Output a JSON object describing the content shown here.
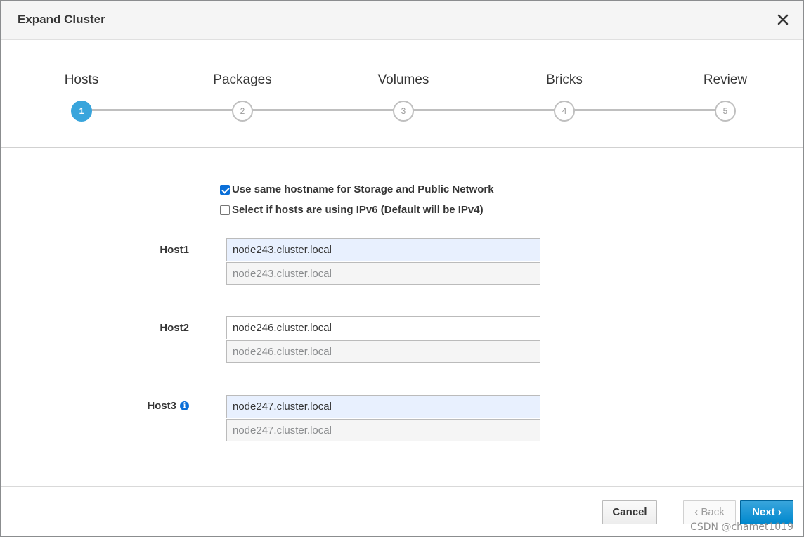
{
  "modal": {
    "title": "Expand Cluster",
    "close_icon": "close-icon"
  },
  "wizard": {
    "steps": [
      {
        "label": "Hosts",
        "number": "1",
        "active": true
      },
      {
        "label": "Packages",
        "number": "2",
        "active": false
      },
      {
        "label": "Volumes",
        "number": "3",
        "active": false
      },
      {
        "label": "Bricks",
        "number": "4",
        "active": false
      },
      {
        "label": "Review",
        "number": "5",
        "active": false
      }
    ]
  },
  "options": {
    "same_hostname": {
      "label": "Use same hostname for Storage and Public Network",
      "checked": true
    },
    "ipv6": {
      "label": "Select if hosts are using IPv6 (Default will be IPv4)",
      "checked": false
    }
  },
  "hosts": [
    {
      "label": "Host1",
      "value": "node243.cluster.local",
      "public_value": "node243.cluster.local"
    },
    {
      "label": "Host2",
      "value": "node246.cluster.local",
      "public_value": "node246.cluster.local"
    },
    {
      "label": "Host3",
      "value": "node247.cluster.local",
      "public_value": "node247.cluster.local",
      "info_icon": "info-icon"
    }
  ],
  "footer": {
    "cancel_label": "Cancel",
    "back_label": "‹ Back",
    "next_label": "Next ›"
  },
  "watermark": "CSDN @chamet1019",
  "colors": {
    "accent": "#39a5dc",
    "primary_button": "#0088ce",
    "checkbox": "#0b6fd8"
  }
}
